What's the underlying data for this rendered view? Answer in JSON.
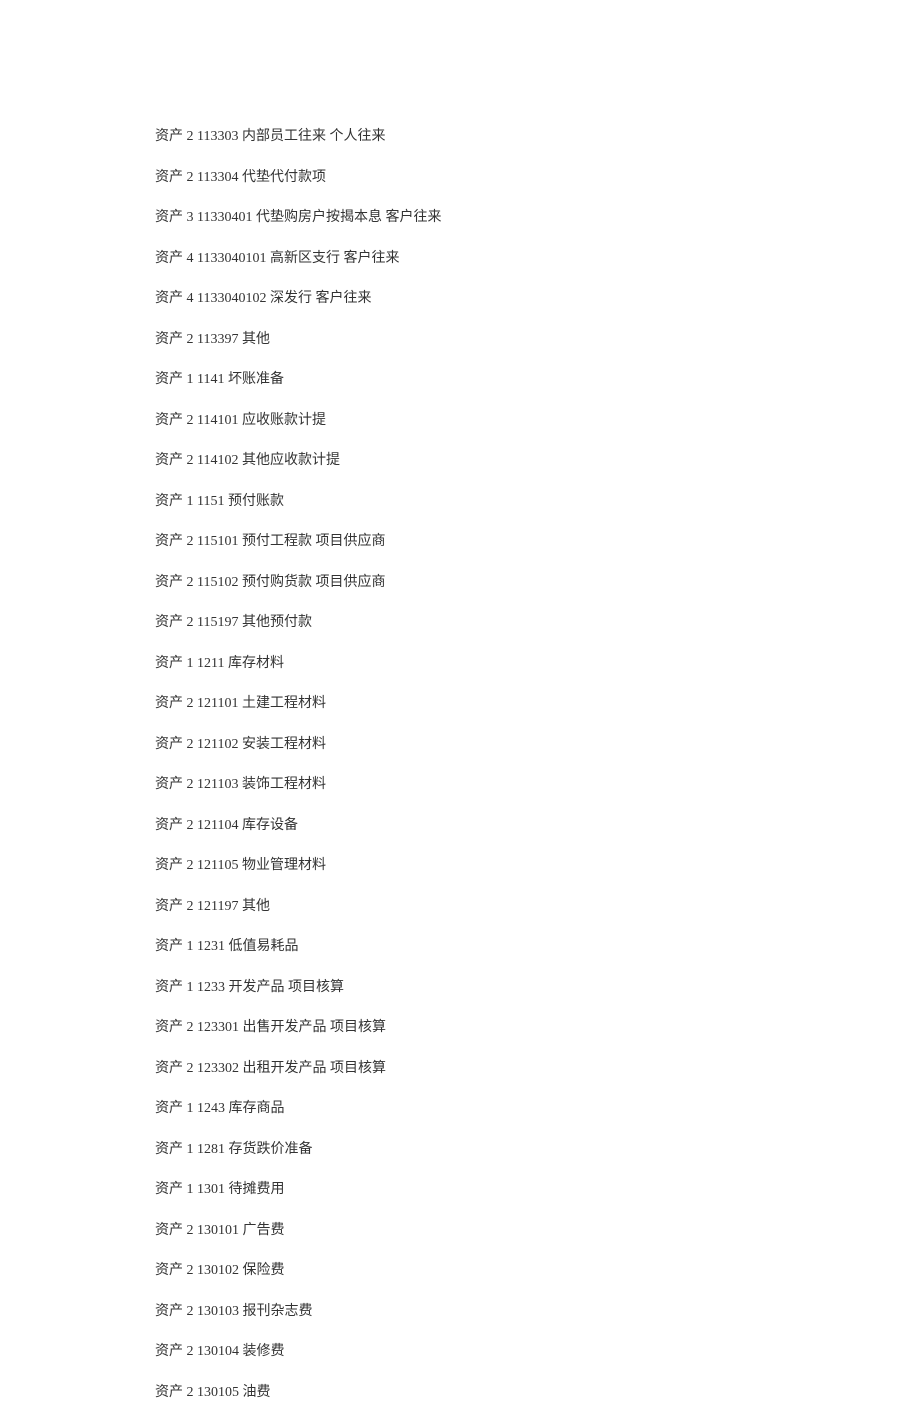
{
  "entries": [
    {
      "category": "资产",
      "level": "2",
      "code": "113303",
      "name": "内部员工往来",
      "aux": "个人往来"
    },
    {
      "category": "资产",
      "level": "2",
      "code": "113304",
      "name": "代垫代付款项",
      "aux": ""
    },
    {
      "category": "资产",
      "level": "3",
      "code": "11330401",
      "name": "代垫购房户按揭本息",
      "aux": "客户往来"
    },
    {
      "category": "资产",
      "level": "4",
      "code": "1133040101",
      "name": "高新区支行",
      "aux": "客户往来"
    },
    {
      "category": "资产",
      "level": "4",
      "code": "1133040102",
      "name": "深发行",
      "aux": "客户往来"
    },
    {
      "category": "资产",
      "level": "2",
      "code": "113397",
      "name": "其他",
      "aux": ""
    },
    {
      "category": "资产",
      "level": "1",
      "code": "1141",
      "name": "坏账准备",
      "aux": ""
    },
    {
      "category": "资产",
      "level": "2",
      "code": "114101",
      "name": "应收账款计提",
      "aux": ""
    },
    {
      "category": "资产",
      "level": "2",
      "code": "114102",
      "name": "其他应收款计提",
      "aux": ""
    },
    {
      "category": "资产",
      "level": "1",
      "code": "1151",
      "name": "预付账款",
      "aux": ""
    },
    {
      "category": "资产",
      "level": "2",
      "code": "115101",
      "name": "预付工程款",
      "aux": "项目供应商"
    },
    {
      "category": "资产",
      "level": "2",
      "code": "115102",
      "name": "预付购货款",
      "aux": "项目供应商"
    },
    {
      "category": "资产",
      "level": "2",
      "code": "115197",
      "name": "其他预付款",
      "aux": ""
    },
    {
      "category": "资产",
      "level": "1",
      "code": "1211",
      "name": "库存材料",
      "aux": ""
    },
    {
      "category": "资产",
      "level": "2",
      "code": "121101",
      "name": "土建工程材料",
      "aux": ""
    },
    {
      "category": "资产",
      "level": "2",
      "code": "121102",
      "name": "安装工程材料",
      "aux": ""
    },
    {
      "category": "资产",
      "level": "2",
      "code": "121103",
      "name": "装饰工程材料",
      "aux": ""
    },
    {
      "category": "资产",
      "level": "2",
      "code": "121104",
      "name": "库存设备",
      "aux": ""
    },
    {
      "category": "资产",
      "level": "2",
      "code": "121105",
      "name": "物业管理材料",
      "aux": ""
    },
    {
      "category": "资产",
      "level": "2",
      "code": "121197",
      "name": "其他",
      "aux": ""
    },
    {
      "category": "资产",
      "level": "1",
      "code": "1231",
      "name": "低值易耗品",
      "aux": ""
    },
    {
      "category": "资产",
      "level": "1",
      "code": "1233",
      "name": "开发产品",
      "aux": "项目核算"
    },
    {
      "category": "资产",
      "level": "2",
      "code": "123301",
      "name": "出售开发产品",
      "aux": "项目核算"
    },
    {
      "category": "资产",
      "level": "2",
      "code": "123302",
      "name": "出租开发产品",
      "aux": "项目核算"
    },
    {
      "category": "资产",
      "level": "1",
      "code": "1243",
      "name": "库存商品",
      "aux": ""
    },
    {
      "category": "资产",
      "level": "1",
      "code": "1281",
      "name": "存货跌价准备",
      "aux": ""
    },
    {
      "category": "资产",
      "level": "1",
      "code": "1301",
      "name": "待摊费用",
      "aux": ""
    },
    {
      "category": "资产",
      "level": "2",
      "code": "130101",
      "name": "广告费",
      "aux": ""
    },
    {
      "category": "资产",
      "level": "2",
      "code": "130102",
      "name": "保险费",
      "aux": ""
    },
    {
      "category": "资产",
      "level": "2",
      "code": "130103",
      "name": "报刊杂志费",
      "aux": ""
    },
    {
      "category": "资产",
      "level": "2",
      "code": "130104",
      "name": "装修费",
      "aux": ""
    },
    {
      "category": "资产",
      "level": "2",
      "code": "130105",
      "name": "油费",
      "aux": ""
    }
  ]
}
